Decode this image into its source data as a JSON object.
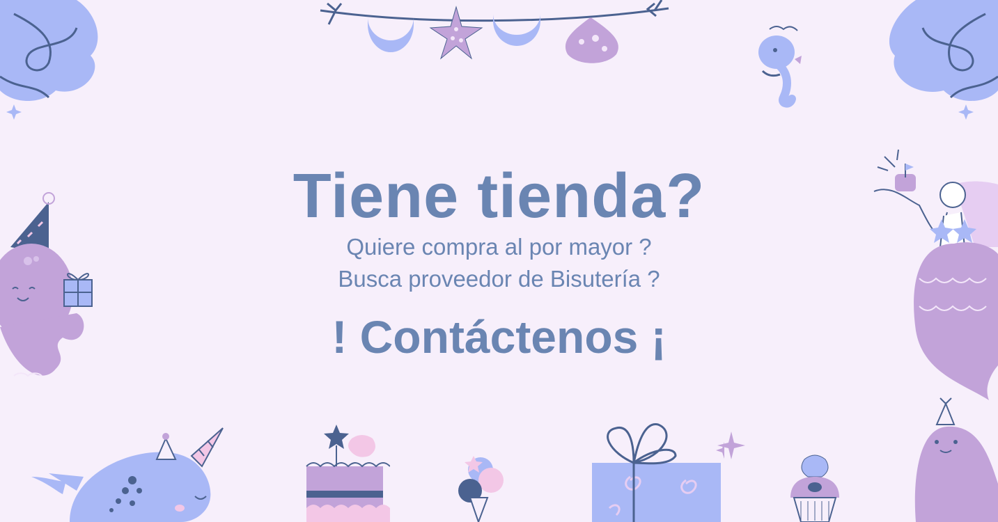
{
  "banner": {
    "title": "Tiene tienda?",
    "line1": "Quiere compra al por mayor ?",
    "line2": "Busca proveedor de Bisutería ?",
    "cta": "! Contáctenos ¡"
  },
  "colors": {
    "background": "#f7effb",
    "text": "#6a85b2",
    "blue": "#a9b8f6",
    "purple": "#c2a3d9",
    "navy": "#4b6290",
    "pink": "#f3c7e6"
  },
  "decorations": [
    "coral-icon",
    "starfish-garland-icon",
    "seahorse-icon",
    "octopus-icon",
    "mermaid-icon",
    "narwhal-icon",
    "cake-icon",
    "ice-cream-icon",
    "gift-box-icon",
    "cupcake-icon",
    "seal-icon"
  ]
}
